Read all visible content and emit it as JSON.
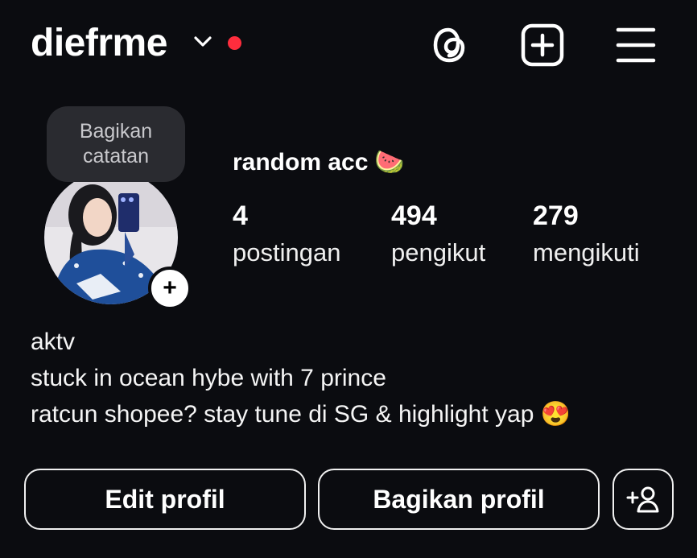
{
  "header": {
    "username": "diefrme",
    "icons": [
      "threads-icon",
      "plus-square-icon",
      "hamburger-menu-icon"
    ],
    "notification_dot_color": "#ff2d3d"
  },
  "note": {
    "line1": "Bagikan",
    "line2": "catatan"
  },
  "profile": {
    "display_name": "random acc",
    "display_name_emoji": "🍉",
    "stats": [
      {
        "value": "4",
        "label": "postingan"
      },
      {
        "value": "494",
        "label": "pengikut"
      },
      {
        "value": "279",
        "label": "mengikuti"
      }
    ]
  },
  "bio": {
    "lines": [
      "aktv",
      "stuck in ocean hybe with 7 prince",
      "ratcun shopee? stay tune di SG & highlight yap 😍"
    ]
  },
  "buttons": {
    "edit_profile": "Edit profil",
    "share_profile": "Bagikan profil",
    "discover_people_icon": "add-person-icon"
  },
  "add_story_symbol": "+",
  "colors": {
    "background": "#0b0c10",
    "note_bubble": "#2a2b30",
    "text": "#f5f5f5"
  }
}
